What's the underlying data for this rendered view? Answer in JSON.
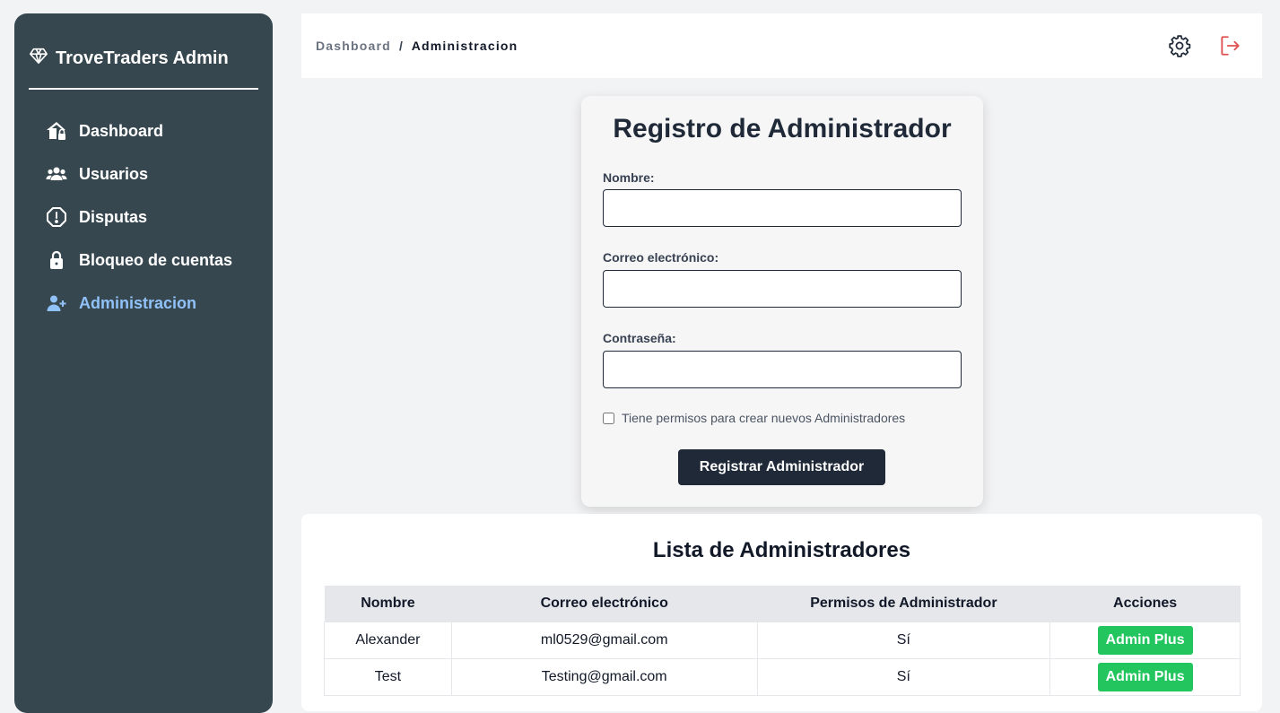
{
  "brand": {
    "name": "TroveTraders Admin",
    "icon": "diamond-icon"
  },
  "sidebar": {
    "items": [
      {
        "label": "Dashboard",
        "icon": "home-lock-icon"
      },
      {
        "label": "Usuarios",
        "icon": "users-icon"
      },
      {
        "label": "Disputas",
        "icon": "alert-octagon-icon"
      },
      {
        "label": "Bloqueo de cuentas",
        "icon": "lock-icon"
      },
      {
        "label": "Administracion",
        "icon": "user-plus-icon",
        "active": true
      }
    ]
  },
  "header": {
    "breadcrumb": {
      "parent": "Dashboard",
      "separator": "/",
      "current": "Administracion"
    },
    "icons": [
      "gear-icon",
      "logout-icon"
    ]
  },
  "form": {
    "title": "Registro de Administrador",
    "name_label": "Nombre:",
    "name_value": "",
    "email_label": "Correo electrónico:",
    "email_value": "",
    "password_label": "Contraseña:",
    "password_value": "",
    "checkbox_label": "Tiene permisos para crear nuevos Administradores",
    "checkbox_checked": false,
    "submit_label": "Registrar Administrador"
  },
  "admin_list": {
    "title": "Lista de Administradores",
    "columns": [
      "Nombre",
      "Correo electrónico",
      "Permisos de Administrador",
      "Acciones"
    ],
    "rows": [
      {
        "name": "Alexander",
        "email": "ml0529@gmail.com",
        "permission": "Sí",
        "action": "Admin Plus"
      },
      {
        "name": "Test",
        "email": "Testing@gmail.com",
        "permission": "Sí",
        "action": "Admin Plus"
      }
    ]
  },
  "colors": {
    "sidebar_bg": "#37474f",
    "active_nav": "#90c2f9",
    "primary_button": "#1f2937",
    "badge_green": "#22c55e",
    "logout_red": "#e05252"
  }
}
